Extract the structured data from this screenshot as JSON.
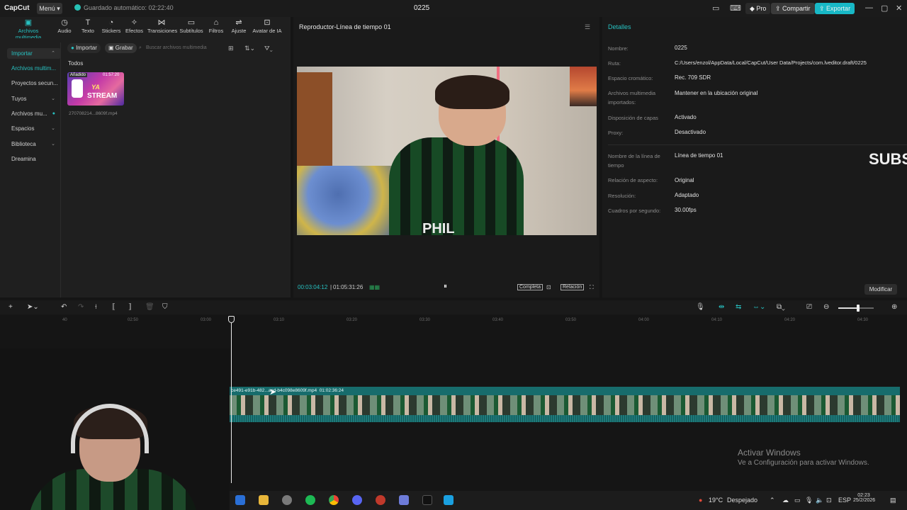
{
  "titlebar": {
    "app_name": "CapCut",
    "menu_label": "Menú",
    "autosave_text": "Guardado automático: 02:22:40",
    "project_name": "0225",
    "pro_label": "Pro",
    "share_label": "Compartir",
    "export_label": "Exportar"
  },
  "toolbar": {
    "tabs": [
      {
        "label": "Archivos multimedia",
        "icon": "media-icon"
      },
      {
        "label": "Audio",
        "icon": "audio-icon"
      },
      {
        "label": "Texto",
        "icon": "text-icon"
      },
      {
        "label": "Stickers",
        "icon": "sticker-icon"
      },
      {
        "label": "Efectos",
        "icon": "effects-icon"
      },
      {
        "label": "Transiciones",
        "icon": "transitions-icon"
      },
      {
        "label": "Subtítulos",
        "icon": "subtitles-icon"
      },
      {
        "label": "Filtros",
        "icon": "filters-icon"
      },
      {
        "label": "Ajuste",
        "icon": "adjust-icon"
      },
      {
        "label": "Avatar de IA",
        "icon": "ai-avatar-icon"
      }
    ]
  },
  "media": {
    "sidebar": [
      {
        "label": "Importar"
      },
      {
        "label": "Archivos multim..."
      },
      {
        "label": "Proyectos secun..."
      },
      {
        "label": "Tuyos"
      },
      {
        "label": "Archivos mu..."
      },
      {
        "label": "Espacios"
      },
      {
        "label": "Biblioteca"
      },
      {
        "label": "Dreamina"
      }
    ],
    "import_label": "Importar",
    "record_label": "Grabar",
    "search_placeholder": "Buscar archivos multimedia",
    "filter_all": "Todos",
    "clip": {
      "badge": "Añadido",
      "duration": "01:57:20",
      "filename": "270708214...8609f.mp4",
      "thumb_text_line1": "YA",
      "thumb_text_line2": "STREAM"
    }
  },
  "player": {
    "title": "Reproductor-Línea de tiempo 01",
    "current_time": "00:03:04:12",
    "total_time": "01:05:31:26",
    "complete_label": "Completa",
    "ratio_label": "Relación",
    "shirt_text": "PHIL"
  },
  "details": {
    "title": "Detalles",
    "rows": [
      {
        "label": "Nombre:",
        "value": "0225"
      },
      {
        "label": "Ruta:",
        "value": "C:/Users/enzol/AppData/Local/CapCut/User Data/Projects/com.lveditor.draft/0225"
      },
      {
        "label": "Espacio cromático:",
        "value": "Rec. 709 SDR"
      },
      {
        "label": "Archivos multimedia importados:",
        "value": "Mantener en la ubicación original"
      },
      {
        "label": "Disposición de capas",
        "value": "Activado"
      },
      {
        "label": "Proxy:",
        "value": "Desactivado"
      },
      {
        "label": "Nombre de la línea de tiempo",
        "value": "Línea de tiempo 01"
      },
      {
        "label": "Relación de aspecto:",
        "value": "Original"
      },
      {
        "label": "Resolución:",
        "value": "Adaptado"
      },
      {
        "label": "Cuadros por segundo:",
        "value": "30.00fps"
      }
    ],
    "overlay_text": "SUBS",
    "modify_label": "Modificar"
  },
  "timeline": {
    "ruler_ticks": [
      "40",
      "02:50",
      "03:00",
      "03:10",
      "03:20",
      "03:30",
      "03:40",
      "03:50",
      "04:00",
      "04:10",
      "04:20",
      "04:30"
    ],
    "clip_label": "ce491-e91b-482...acd-b4c098e8609f.mp4",
    "clip_duration": "01:02:36:24"
  },
  "watermark": {
    "line1": "Activar Windows",
    "line2": "Ve a Configuración para activar Windows."
  },
  "taskbar": {
    "weather": "19°C",
    "weather_desc": "Despejado",
    "lang": "ESP",
    "time": "02:23",
    "date": "25/2/2026"
  }
}
